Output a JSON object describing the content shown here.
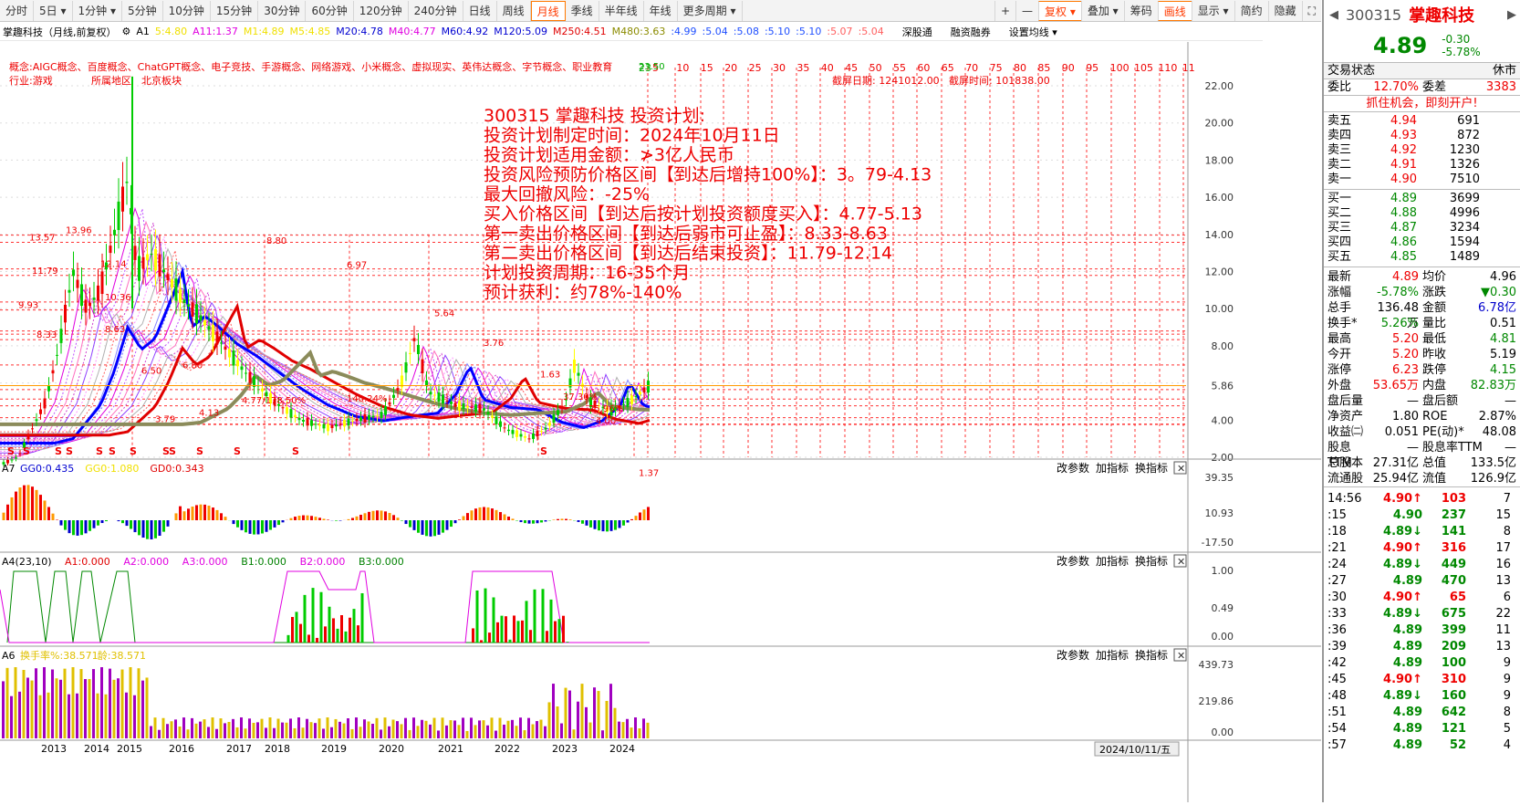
{
  "toolbar": {
    "periods": [
      "分时",
      "5日",
      "1分钟",
      "5分钟",
      "10分钟",
      "15分钟",
      "30分钟",
      "60分钟",
      "120分钟",
      "240分钟",
      "日线",
      "周线",
      "月线",
      "季线",
      "半年线",
      "年线",
      "更多周期"
    ],
    "right": [
      "复权",
      "叠加",
      "筹码",
      "画线",
      "显示",
      "简约",
      "隐藏"
    ]
  },
  "indicator_bar": {
    "name": "掌趣科技（月线,前复权）",
    "a1": "A1",
    "vals": [
      {
        "t": "5:4.80",
        "c": "#f0e000"
      },
      {
        "t": "A11:1.37",
        "c": "#e000e0"
      },
      {
        "t": "M1:4.89",
        "c": "#f0e000"
      },
      {
        "t": "M5:4.85",
        "c": "#f0e000"
      },
      {
        "t": "M20:4.78",
        "c": "#0000d0"
      },
      {
        "t": "M40:4.77",
        "c": "#e000e0"
      },
      {
        "t": "M60:4.92",
        "c": "#0000d0"
      },
      {
        "t": "M120:5.09",
        "c": "#0000d0"
      },
      {
        "t": "M250:4.51",
        "c": "#e00000"
      },
      {
        "t": "M480:3.63",
        "c": "#8b8b00"
      },
      {
        "t": ":4.99",
        "c": "#2050ff"
      },
      {
        "t": ":5.04",
        "c": "#2050ff"
      },
      {
        "t": ":5.08",
        "c": "#2050ff"
      },
      {
        "t": ":5.10",
        "c": "#2050ff"
      },
      {
        "t": ":5.10",
        "c": "#2050ff"
      },
      {
        "t": ":5.07",
        "c": "#ff6060"
      },
      {
        "t": ":5.04",
        "c": "#ff6060"
      }
    ],
    "links": [
      "深股通",
      "融资融券",
      "设置均线"
    ]
  },
  "concept_line": "概念:AIGC概念、百度概念、ChatGPT概念、电子竞技、手游概念、网络游戏、小米概念、虚拟现实、英伟达概念、字节概念、职业教育",
  "industry_line": "行业:游戏",
  "region": "所属地区",
  "region_val": "北京板块",
  "screenshot_date": "截屏日期: 1241012.00",
  "screenshot_time": "截屏时间: 101838.00",
  "timer_nums": [
    "23",
    "5",
    "10",
    "15",
    "20",
    "25",
    "30",
    "35",
    "40",
    "45",
    "50",
    "55",
    "60",
    "65",
    "70",
    "75",
    "80",
    "85",
    "90",
    "95",
    "100",
    "105",
    "110",
    "11"
  ],
  "plan": [
    "300315  掌趣科技  投资计划:",
    "投资计划制定时间：2024年10月11日",
    "投资计划适用金额：≯3亿人民币",
    "投资风险预防价格区间【到达后增持100%】：3。79-4.13",
    "最大回撤风险：-25%",
    "买入价格区间【到达后按计划投资额度买入】：4.77-5.13",
    "第一卖出价格区间【到达后弱市可止盈】：8.33-8.63",
    "第二卖出价格区间【到达后结束投资】：11.79-12.14",
    "计划投资周期：16-35个月",
    "预计获利：约78%-140%"
  ],
  "price_axis": [
    "22.00",
    "20.00",
    "18.00",
    "16.00",
    "14.00",
    "12.00",
    "10.00",
    "8.00",
    "5.86",
    "4.00",
    "2.00"
  ],
  "chart_labels": {
    "l1357": "13.57",
    "l1396": "13.96",
    "l1179": "11.79",
    "l1214": "12.14",
    "l1036": "10.36",
    "l993": "9.93",
    "l833": "8.33",
    "l863": "8.63",
    "l880": "8.80",
    "l697": "6.97",
    "l564": "5.64",
    "l376": "3.76",
    "l650": "6.50",
    "l680": "6.80",
    "l477": "4.77/178.50%",
    "l413": "4.13",
    "l379": "3.79",
    "l137": "1.37",
    "l163": "1.63",
    "l14024": "140.24%",
    "l3730": "37.30%",
    "l2596": "25.96%",
    "l400": "4.00",
    "l2350": "23.50"
  },
  "sub1": {
    "name": "A7",
    "vals": [
      {
        "t": "GG0:0.435",
        "c": "#0000d0"
      },
      {
        "t": "GG0:1.080",
        "c": "#f0e000"
      },
      {
        "t": "GD0:0.343",
        "c": "#e00000"
      }
    ],
    "axis": [
      "39.35",
      "10.93",
      "-17.50"
    ]
  },
  "sub2": {
    "name": "A4(23,10)",
    "vals": [
      {
        "t": "A1:0.000",
        "c": "#e00000"
      },
      {
        "t": "A2:0.000",
        "c": "#e000e0"
      },
      {
        "t": "A3:0.000",
        "c": "#e000e0"
      },
      {
        "t": "B1:0.000",
        "c": "#008000"
      },
      {
        "t": "B2:0.000",
        "c": "#e000e0"
      },
      {
        "t": "B3:0.000",
        "c": "#008000"
      }
    ],
    "axis": [
      "1.00",
      "0.49",
      "0.00"
    ]
  },
  "sub3": {
    "name": "A6",
    "vals": [
      {
        "t": "换手率%:38.571",
        "c": "#e0c000"
      },
      {
        "t": "龄:38.571",
        "c": "#e0c000"
      }
    ],
    "axis": [
      "439.73",
      "219.86",
      "0.00"
    ]
  },
  "sub_btns": [
    "改参数",
    "加指标",
    "换指标"
  ],
  "xaxis": [
    "2013",
    "2014",
    "2015",
    "2016",
    "2017",
    "2018",
    "2019",
    "2020",
    "2021",
    "2022",
    "2023",
    "2024"
  ],
  "date_box": "2024/10/11/五",
  "quote": {
    "code": "300315",
    "name": "掌趣科技",
    "price": "4.89",
    "chg": "-0.30",
    "pct": "-5.78%",
    "status_l": "交易状态",
    "status_r": "休市",
    "wb_l": "委比",
    "wb_v": "12.70%",
    "wc_l": "委差",
    "wc_v": "3383",
    "promo": "抓住机会，即刻开户!",
    "asks": [
      [
        "卖五",
        "4.94",
        "691"
      ],
      [
        "卖四",
        "4.93",
        "872"
      ],
      [
        "卖三",
        "4.92",
        "1230"
      ],
      [
        "卖二",
        "4.91",
        "1326"
      ],
      [
        "卖一",
        "4.90",
        "7510"
      ]
    ],
    "bids": [
      [
        "买一",
        "4.89",
        "3699"
      ],
      [
        "买二",
        "4.88",
        "4996"
      ],
      [
        "买三",
        "4.87",
        "3234"
      ],
      [
        "买四",
        "4.86",
        "1594"
      ],
      [
        "买五",
        "4.85",
        "1489"
      ]
    ],
    "stats": [
      [
        "最新",
        "4.89",
        "均价",
        "4.96"
      ],
      [
        "涨幅",
        "-5.78%",
        "涨跌",
        "▼0.30"
      ],
      [
        "总手",
        "136.48万",
        "金额",
        "6.78亿"
      ],
      [
        "换手*",
        "5.26%",
        "量比",
        "0.51"
      ],
      [
        "最高",
        "5.20",
        "最低",
        "4.81"
      ],
      [
        "今开",
        "5.20",
        "昨收",
        "5.19"
      ],
      [
        "涨停",
        "6.23",
        "跌停",
        "4.15"
      ],
      [
        "外盘",
        "53.65万",
        "内盘",
        "82.83万"
      ],
      [
        "盘后量",
        "—",
        "盘后额",
        "—"
      ],
      [
        "净资产",
        "1.80",
        "ROE",
        "2.87%"
      ],
      [
        "收益㈡",
        "0.051",
        "PE(动)*",
        "48.08"
      ],
      [
        "股息TTM",
        "—",
        "股息率TTM",
        "—"
      ],
      [
        "总股本",
        "27.31亿",
        "总值",
        "133.5亿"
      ],
      [
        "流通股",
        "25.94亿",
        "流值",
        "126.9亿"
      ]
    ],
    "ticks": [
      [
        "14:56",
        "4.90↑",
        "103",
        "7"
      ],
      [
        ":15",
        "4.90",
        "237",
        "15"
      ],
      [
        ":18",
        "4.89↓",
        "141",
        "8"
      ],
      [
        ":21",
        "4.90↑",
        "316",
        "17"
      ],
      [
        ":24",
        "4.89↓",
        "449",
        "16"
      ],
      [
        ":27",
        "4.89",
        "470",
        "13"
      ],
      [
        ":30",
        "4.90↑",
        "65",
        "6"
      ],
      [
        ":33",
        "4.89↓",
        "675",
        "22"
      ],
      [
        ":36",
        "4.89",
        "399",
        "11"
      ],
      [
        ":39",
        "4.89",
        "209",
        "13"
      ],
      [
        ":42",
        "4.89",
        "100",
        "9"
      ],
      [
        ":45",
        "4.90↑",
        "310",
        "9"
      ],
      [
        ":48",
        "4.89↓",
        "160",
        "9"
      ],
      [
        ":51",
        "4.89",
        "642",
        "8"
      ],
      [
        ":54",
        "4.89",
        "121",
        "5"
      ],
      [
        ":57",
        "4.89",
        "52",
        "4"
      ]
    ]
  }
}
